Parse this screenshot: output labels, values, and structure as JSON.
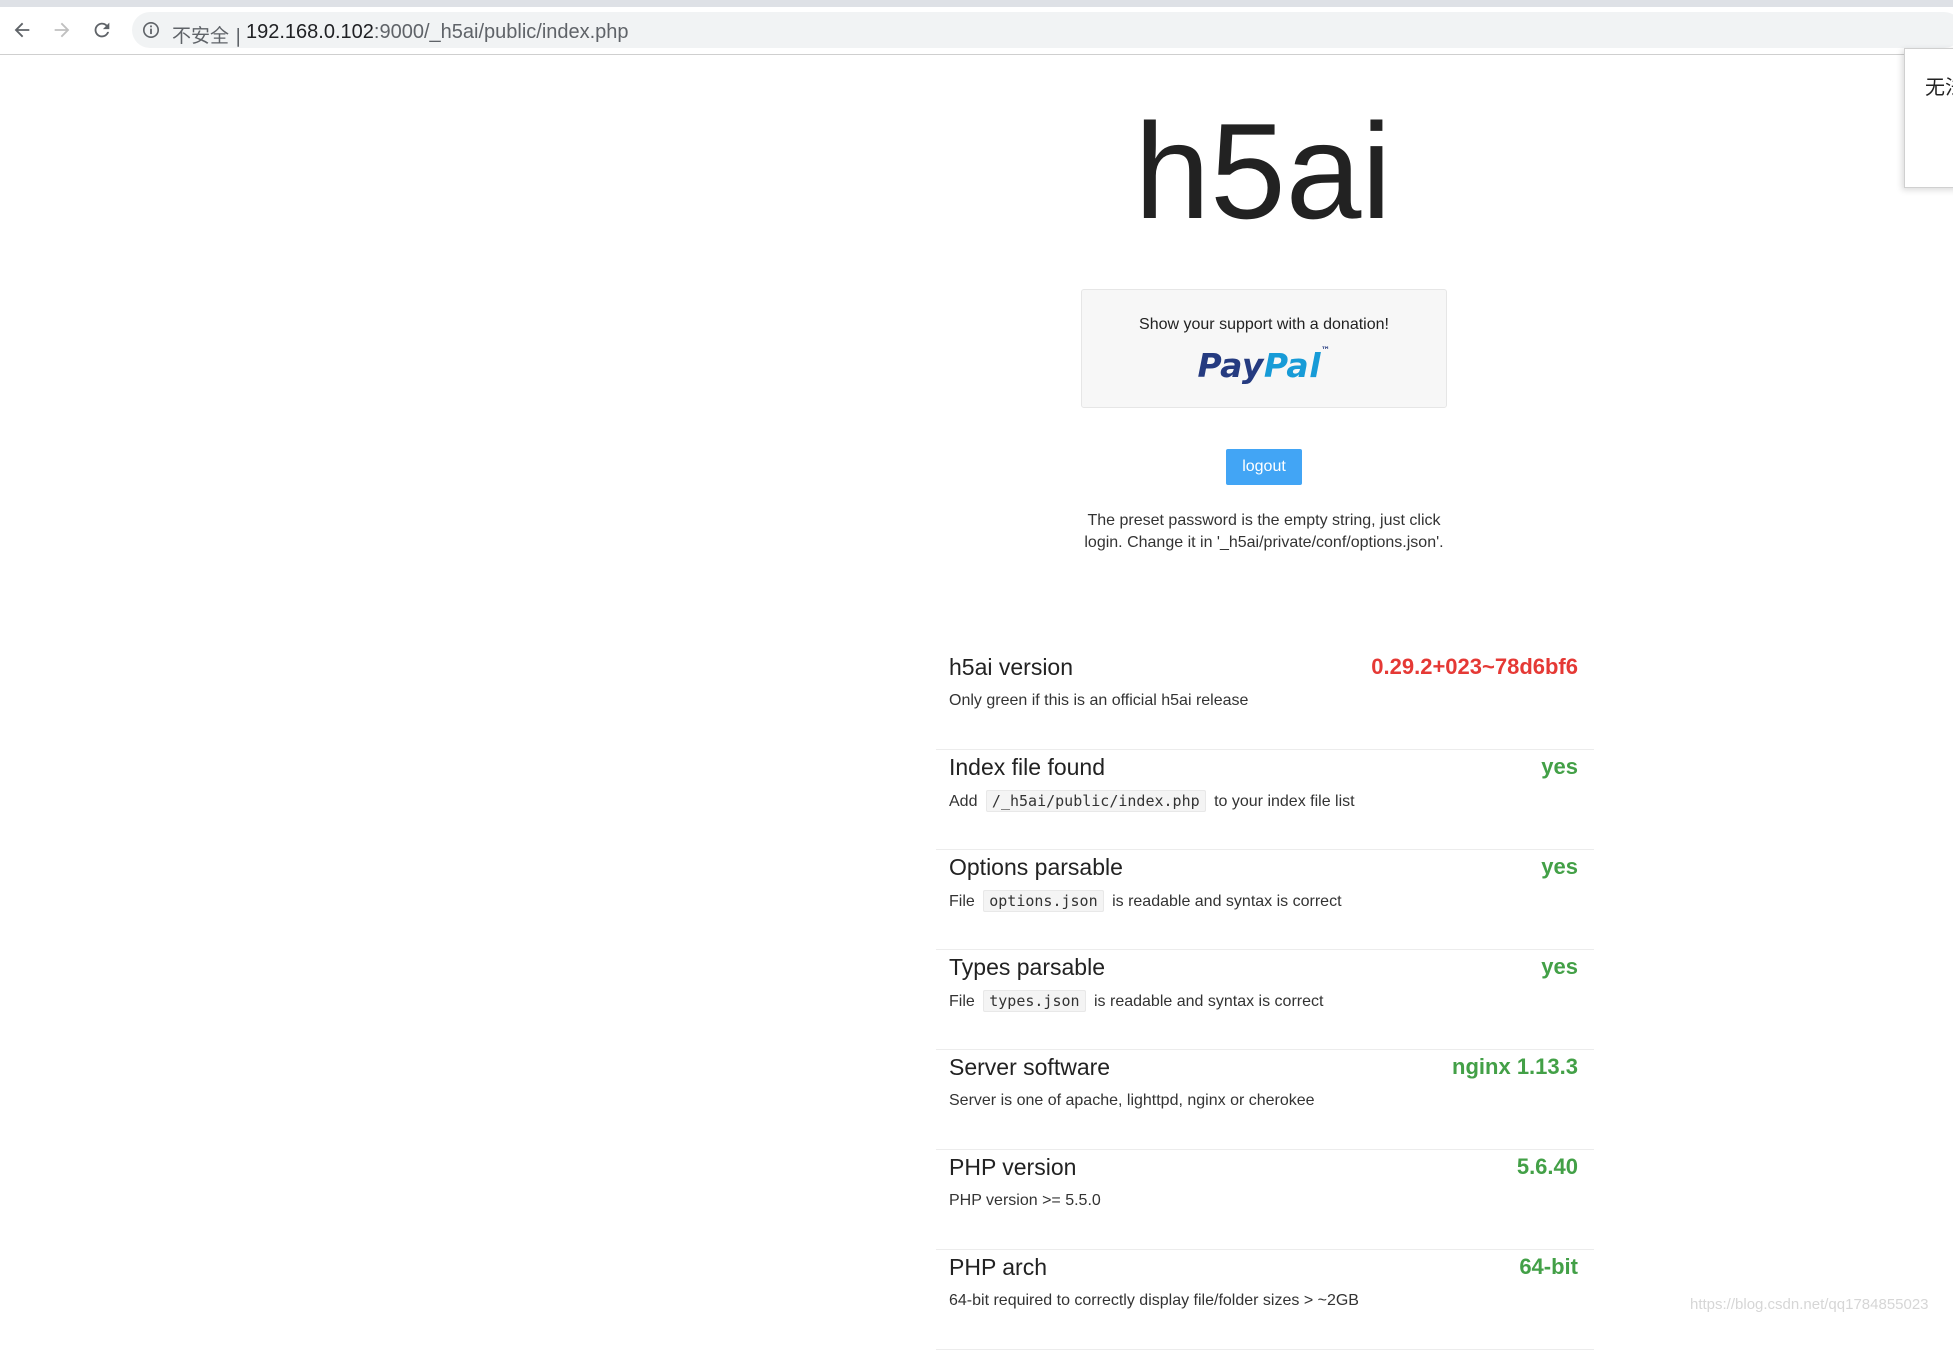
{
  "browser": {
    "security_label": "不安全 |",
    "url_host": "192.168.0.102",
    "url_rest": ":9000/_h5ai/public/index.php",
    "popup_text": "无法"
  },
  "page": {
    "title": "h5ai",
    "donate_text": "Show your support with a donation!",
    "paypal_pay": "Pay",
    "paypal_pal": "Pal",
    "paypal_tm": "™",
    "logout_label": "logout",
    "hint": "The preset password is the empty string, just click login. Change it in '_h5ai/private/conf/options.json'."
  },
  "tests": [
    {
      "label": "h5ai version",
      "result": "0.29.2+023~78d6bf6",
      "status": "bad",
      "info": "Only green if this is an official h5ai release"
    },
    {
      "label": "Index file found",
      "result": "yes",
      "status": "good",
      "info_pre": "Add",
      "info_code": "/_h5ai/public/index.php",
      "info_post": "to your index file list"
    },
    {
      "label": "Options parsable",
      "result": "yes",
      "status": "good",
      "info_pre": "File",
      "info_code": "options.json",
      "info_post": "is readable and syntax is correct"
    },
    {
      "label": "Types parsable",
      "result": "yes",
      "status": "good",
      "info_pre": "File",
      "info_code": "types.json",
      "info_post": "is readable and syntax is correct"
    },
    {
      "label": "Server software",
      "result": "nginx 1.13.3",
      "status": "good",
      "info": "Server is one of apache, lighttpd, nginx or cherokee"
    },
    {
      "label": "PHP version",
      "result": "5.6.40",
      "status": "good",
      "info": "PHP version >= 5.5.0"
    },
    {
      "label": "PHP arch",
      "result": "64-bit",
      "status": "good",
      "info": "64-bit required to correctly display file/folder sizes > ~2GB"
    }
  ],
  "watermark": "https://blog.csdn.net/qq1784855023",
  "colors": {
    "good": "#43a047",
    "bad": "#e53935",
    "button": "#42a5f5"
  }
}
